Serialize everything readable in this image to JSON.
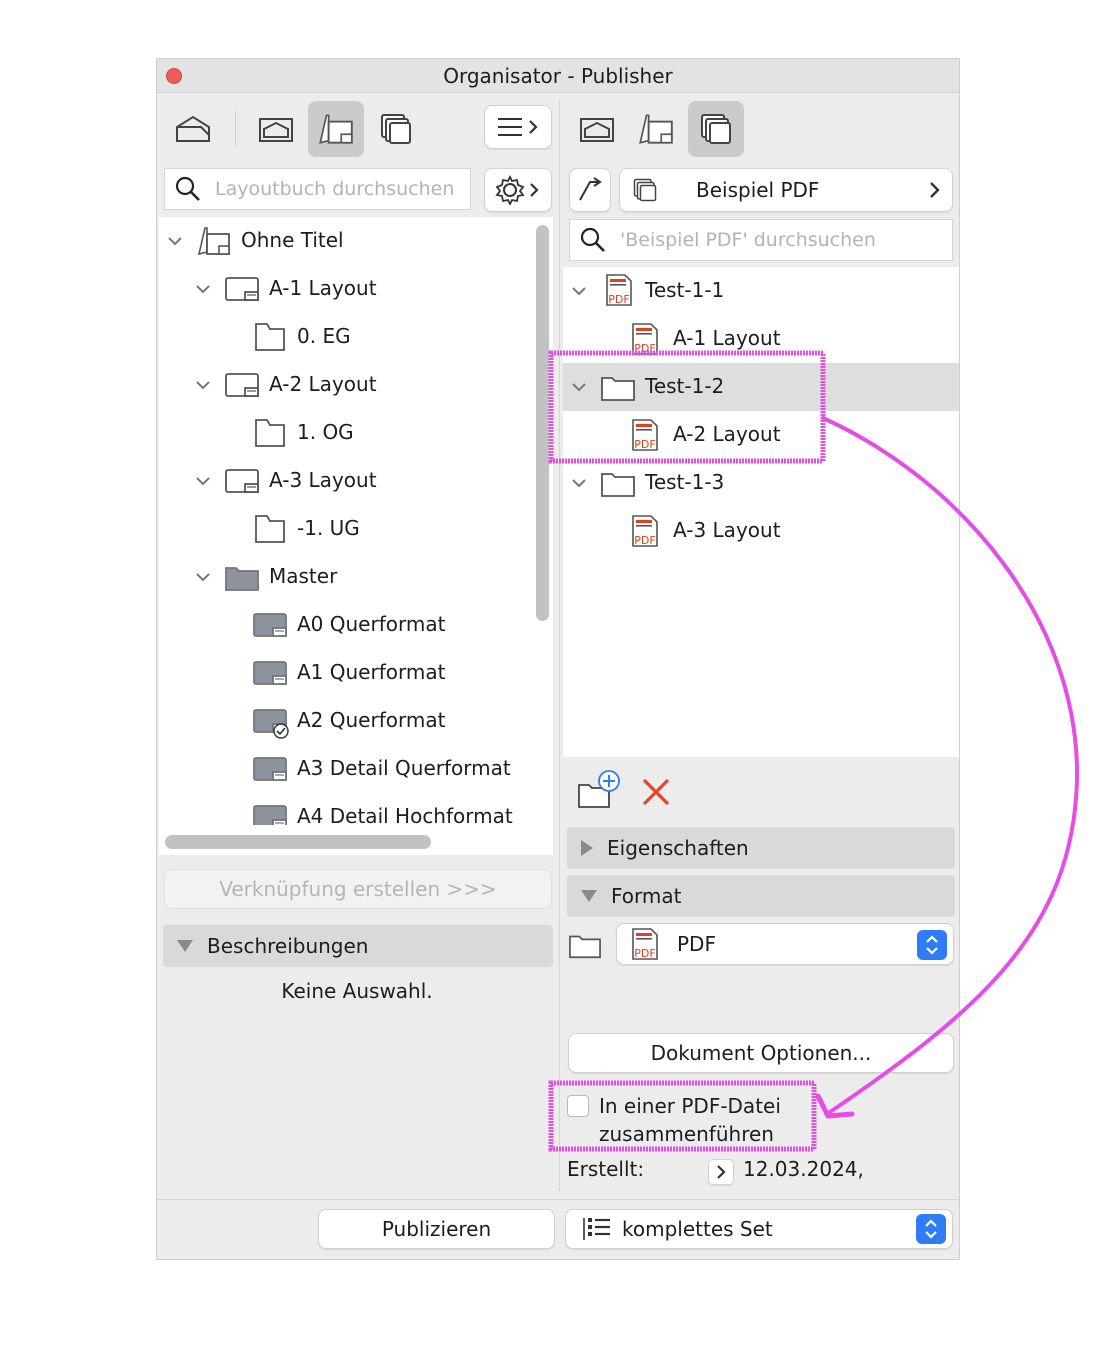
{
  "window": {
    "title": "Organisator - Publisher"
  },
  "left": {
    "search_placeholder": "Layoutbuch durchsuchen",
    "tree": {
      "root": "Ohne Titel",
      "items": [
        {
          "label": "A-1 Layout",
          "child": "0. EG"
        },
        {
          "label": "A-2 Layout",
          "child": "1. OG"
        },
        {
          "label": "A-3 Layout",
          "child": "-1. UG"
        }
      ],
      "master": {
        "label": "Master",
        "items": [
          "A0 Querformat",
          "A1 Querformat",
          "A2 Querformat",
          "A3 Detail Querformat",
          "A4 Detail Hochformat"
        ]
      }
    },
    "link_button": "Verknüpfung erstellen >>>",
    "descriptions_header": "Beschreibungen",
    "no_selection": "Keine Auswahl."
  },
  "right": {
    "set_name": "Beispiel PDF",
    "search_placeholder": "'Beispiel PDF' durchsuchen",
    "tree": [
      {
        "folder": "Test-1-1",
        "child": "A-1 Layout"
      },
      {
        "folder": "Test-1-2",
        "child": "A-2 Layout"
      },
      {
        "folder": "Test-1-3",
        "child": "A-3 Layout"
      }
    ],
    "properties_header": "Eigenschaften",
    "format_header": "Format",
    "format_value": "PDF",
    "doc_options_button": "Dokument Optionen...",
    "merge_label_line1": "In einer PDF-Datei",
    "merge_label_line2": "zusammenführen",
    "created_label": "Erstellt:",
    "created_value": "12.03.2024,"
  },
  "footer": {
    "publish_button": "Publizieren",
    "set_select": "komplettes Set"
  },
  "colors": {
    "annotation": "#e64ce6",
    "accent": "#2f7cf6",
    "pdf_red": "#e2401c",
    "delete_red": "#e8422c"
  },
  "icons": [
    "house-icon",
    "layout-book-icon",
    "layout-icon",
    "publisher-sets-icon",
    "menu-icon",
    "gear-icon",
    "search-icon",
    "folder-icon",
    "pdf-icon",
    "new-folder-icon",
    "delete-icon",
    "list-icon"
  ]
}
